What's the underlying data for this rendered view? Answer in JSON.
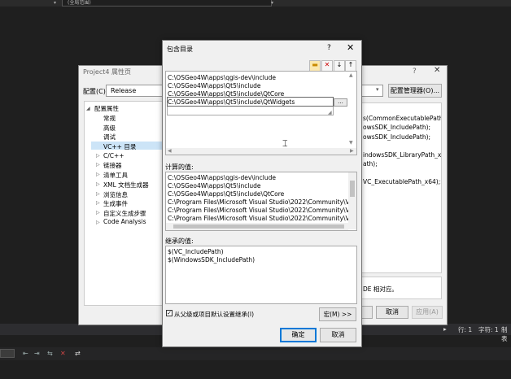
{
  "ide": {
    "top_dropdown": "(全局范围)",
    "status": {
      "line": "行: 1",
      "char": "字符: 1",
      "mode": "制表"
    }
  },
  "property_pages": {
    "title": "Project4 属性页",
    "help": "?",
    "close": "✕",
    "config_label": "配置(C):",
    "config_value": "Release",
    "config_manager": "配置管理器(O)...",
    "tree": {
      "root": "配置属性",
      "items": [
        "常规",
        "高级",
        "调试",
        "VC++ 目录",
        "C/C++",
        "链接器",
        "清单工具",
        "XML 文档生成器",
        "浏览信息",
        "生成事件",
        "自定义生成步骤",
        "Code Analysis"
      ]
    },
    "grid_values": [
      "s(CommonExecutablePath",
      "owsSDK_IncludePath);",
      "owsSDK_IncludePath);",
      "indowsSDK_LibraryPath_x64)",
      "ath);",
      "VC_ExecutablePath_x64);$(VC_I"
    ],
    "description_fragment": "DE 相对应。",
    "cancel": "取消",
    "apply": "应用(A)"
  },
  "include_dialog": {
    "title": "包含目录",
    "help": "?",
    "close": "✕",
    "toolbar": {
      "delete": "✕",
      "down": "↓",
      "up": "↑"
    },
    "entries": [
      "C:\\OSGeo4W\\apps\\qgis-dev\\include",
      "C:\\OSGeo4W\\apps\\Qt5\\include",
      "C:\\OSGeo4W\\apps\\Qt5\\include\\QtCore",
      "C:\\OSGeo4W\\apps\\Qt5\\include\\QtWidgets"
    ],
    "browse": "...",
    "computed_label": "计算的值:",
    "computed_values": [
      "C:\\OSGeo4W\\apps\\qgis-dev\\include",
      "C:\\OSGeo4W\\apps\\Qt5\\include",
      "C:\\OSGeo4W\\apps\\Qt5\\include\\QtCore",
      "C:\\Program Files\\Microsoft Visual Studio\\2022\\Community\\VC\\To",
      "C:\\Program Files\\Microsoft Visual Studio\\2022\\Community\\VC\\To",
      "C:\\Program Files\\Microsoft Visual Studio\\2022\\Community\\VC\\Au"
    ],
    "inherited_label": "继承的值:",
    "inherited_values": [
      "$(VC_IncludePath)",
      "$(WindowsSDK_IncludePath)"
    ],
    "inherit_checkbox": "从父级或项目默认设置继承(I)",
    "macro_button": "宏(M) >>",
    "ok": "确定",
    "cancel": "取消"
  }
}
